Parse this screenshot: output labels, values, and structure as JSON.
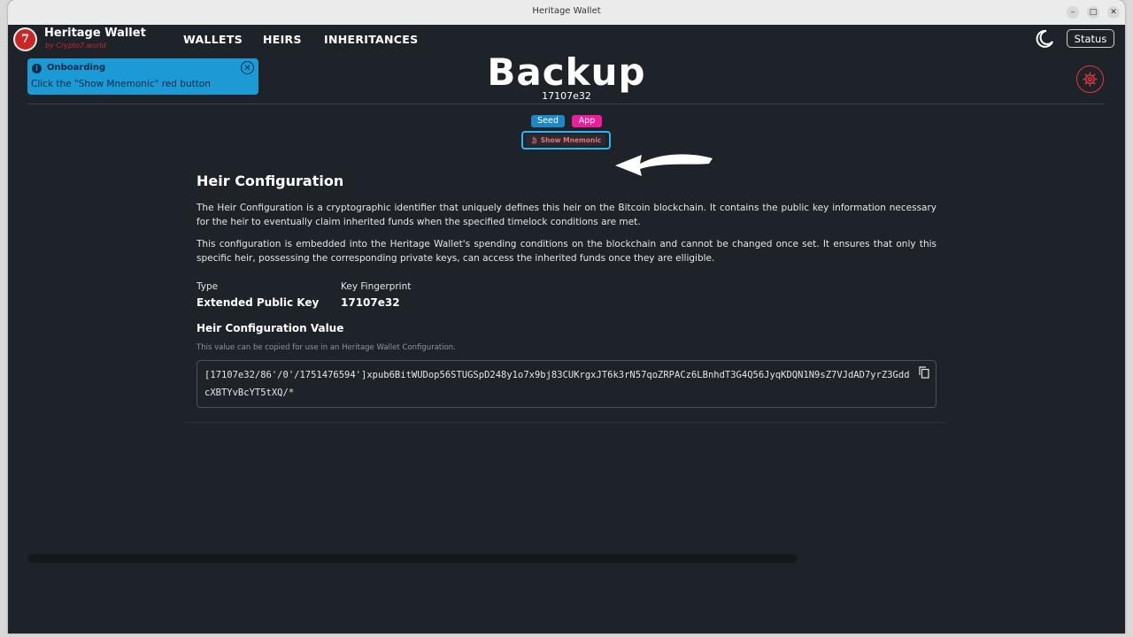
{
  "window": {
    "title": "Heritage Wallet"
  },
  "app": {
    "name": "Heritage Wallet",
    "tagline": "by Crypto7.world",
    "logo_letter": "7"
  },
  "nav": {
    "wallets": "WALLETS",
    "heirs": "HEIRS",
    "inheritances": "INHERITANCES"
  },
  "header": {
    "status_label": "Status",
    "theme_icon": "moon-icon"
  },
  "onboarding": {
    "title": "Onboarding",
    "text": "Click the \"Show Mnemonic\" red button",
    "color": "#1b9ad6"
  },
  "page": {
    "title": "Backup",
    "subtitle": "17107e32"
  },
  "chips": {
    "seed": "Seed",
    "app": "App",
    "seed_color": "#1e88c6",
    "app_color": "#e91e9b"
  },
  "show_mnemonic": {
    "label": "Show Mnemonic",
    "color": "#e57373"
  },
  "heir_config": {
    "heading": "Heir Configuration",
    "para1": "The Heir Configuration is a cryptographic identifier that uniquely defines this heir on the Bitcoin blockchain. It contains the public key information necessary for the heir to eventually claim inherited funds when the specified timelock conditions are met.",
    "para2": "This configuration is embedded into the Heritage Wallet's spending conditions on the blockchain and cannot be changed once set. It ensures that only this specific heir, possessing the corresponding private keys, can access the inherited funds once they are elligible.",
    "type_label": "Type",
    "type_value": "Extended Public Key",
    "fingerprint_label": "Key Fingerprint",
    "fingerprint_value": "17107e32",
    "value_heading": "Heir Configuration Value",
    "value_helper": "This value can be copied for use in an Heritage Wallet Configuration.",
    "value": "[17107e32/86'/0'/1751476594']xpub6BitWUDop56STUGSpD248y1o7x9bj83CUKrgxJT6k3rN57qoZRPACz6LBnhdT3G4Q56JyqKDQN1N9sZ7VJdAD7yrZ3GddcXBTYvBcYT5tXQ/*"
  },
  "accent_colors": {
    "danger": "#e53935",
    "focus": "#29b6f6"
  }
}
